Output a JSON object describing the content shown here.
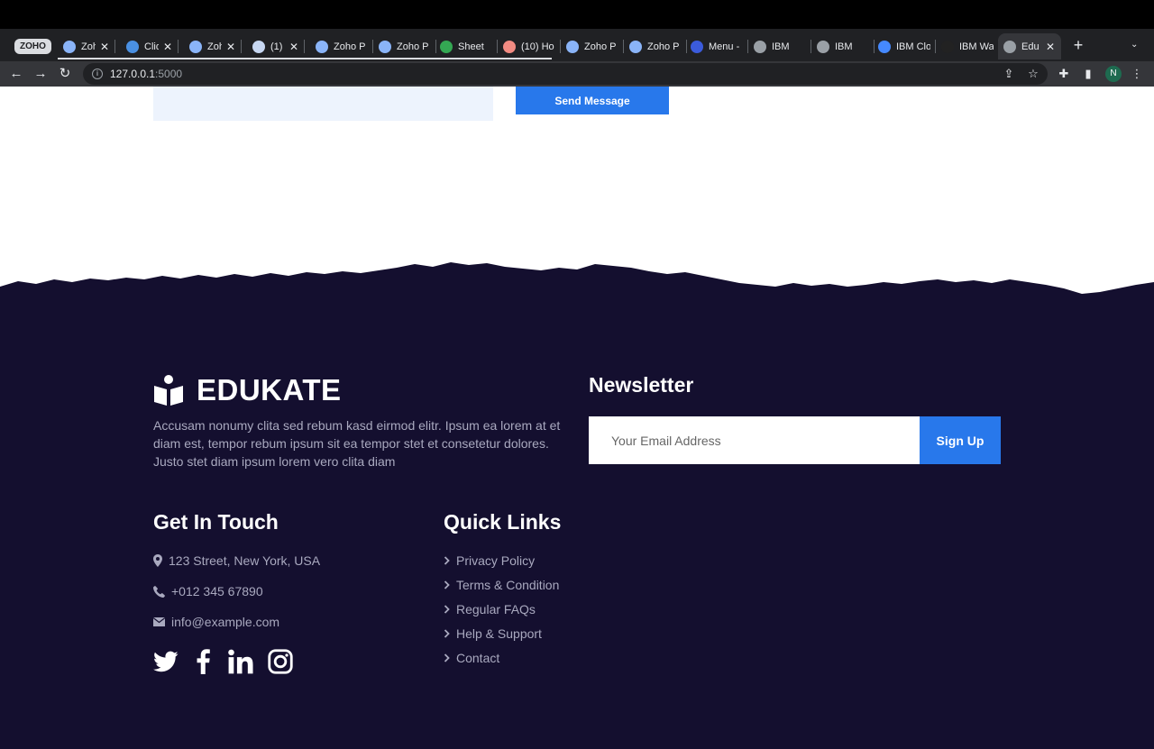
{
  "browser": {
    "tab_group_label": "ZOHO",
    "tabs": [
      {
        "title": "Zoho",
        "color": "#8ab4f8"
      },
      {
        "title": "Cliq",
        "color": "#4a90e2"
      },
      {
        "title": "Zoho",
        "color": "#8ab4f8"
      },
      {
        "title": "(1)",
        "color": "#c7d7f2"
      },
      {
        "title": "Zoho P",
        "color": "#8ab4f8"
      },
      {
        "title": "Zoho P",
        "color": "#8ab4f8"
      },
      {
        "title": "Sheet",
        "color": "#34a853"
      },
      {
        "title": "(10) Ho",
        "color": "#f28b82"
      },
      {
        "title": "Zoho P",
        "color": "#8ab4f8"
      },
      {
        "title": "Zoho P",
        "color": "#8ab4f8"
      },
      {
        "title": "Menu -",
        "color": "#3b5bdb"
      },
      {
        "title": "IBM",
        "color": "#9aa0a6"
      },
      {
        "title": "IBM",
        "color": "#9aa0a6"
      },
      {
        "title": "IBM Clo",
        "color": "#4589ff"
      },
      {
        "title": "IBM Wa",
        "color": "#222222"
      },
      {
        "title": "Edu",
        "color": "#9aa0a6"
      }
    ],
    "address_host": "127.0.0.1",
    "address_port": ":5000",
    "profile_initial": "N"
  },
  "contact_form": {
    "send_label": "Send Message"
  },
  "footer": {
    "brand_name": "EDUKATE",
    "about": "Accusam nonumy clita sed rebum kasd eirmod elitr. Ipsum ea lorem at et diam est, tempor rebum ipsum sit ea tempor stet et consetetur dolores. Justo stet diam ipsum lorem vero clita diam",
    "newsletter": {
      "title": "Newsletter",
      "placeholder": "Your Email Address",
      "button": "Sign Up"
    },
    "get_in_touch": {
      "title": "Get In Touch",
      "address": "123 Street, New York, USA",
      "phone": "+012 345 67890",
      "email": "info@example.com"
    },
    "quick_links": {
      "title": "Quick Links",
      "items": [
        "Privacy Policy",
        "Terms & Condition",
        "Regular FAQs",
        "Help & Support",
        "Contact"
      ]
    }
  },
  "colors": {
    "footer_bg": "#140f2f",
    "accent": "#2878eb",
    "muted_text": "#a9a9bf"
  }
}
